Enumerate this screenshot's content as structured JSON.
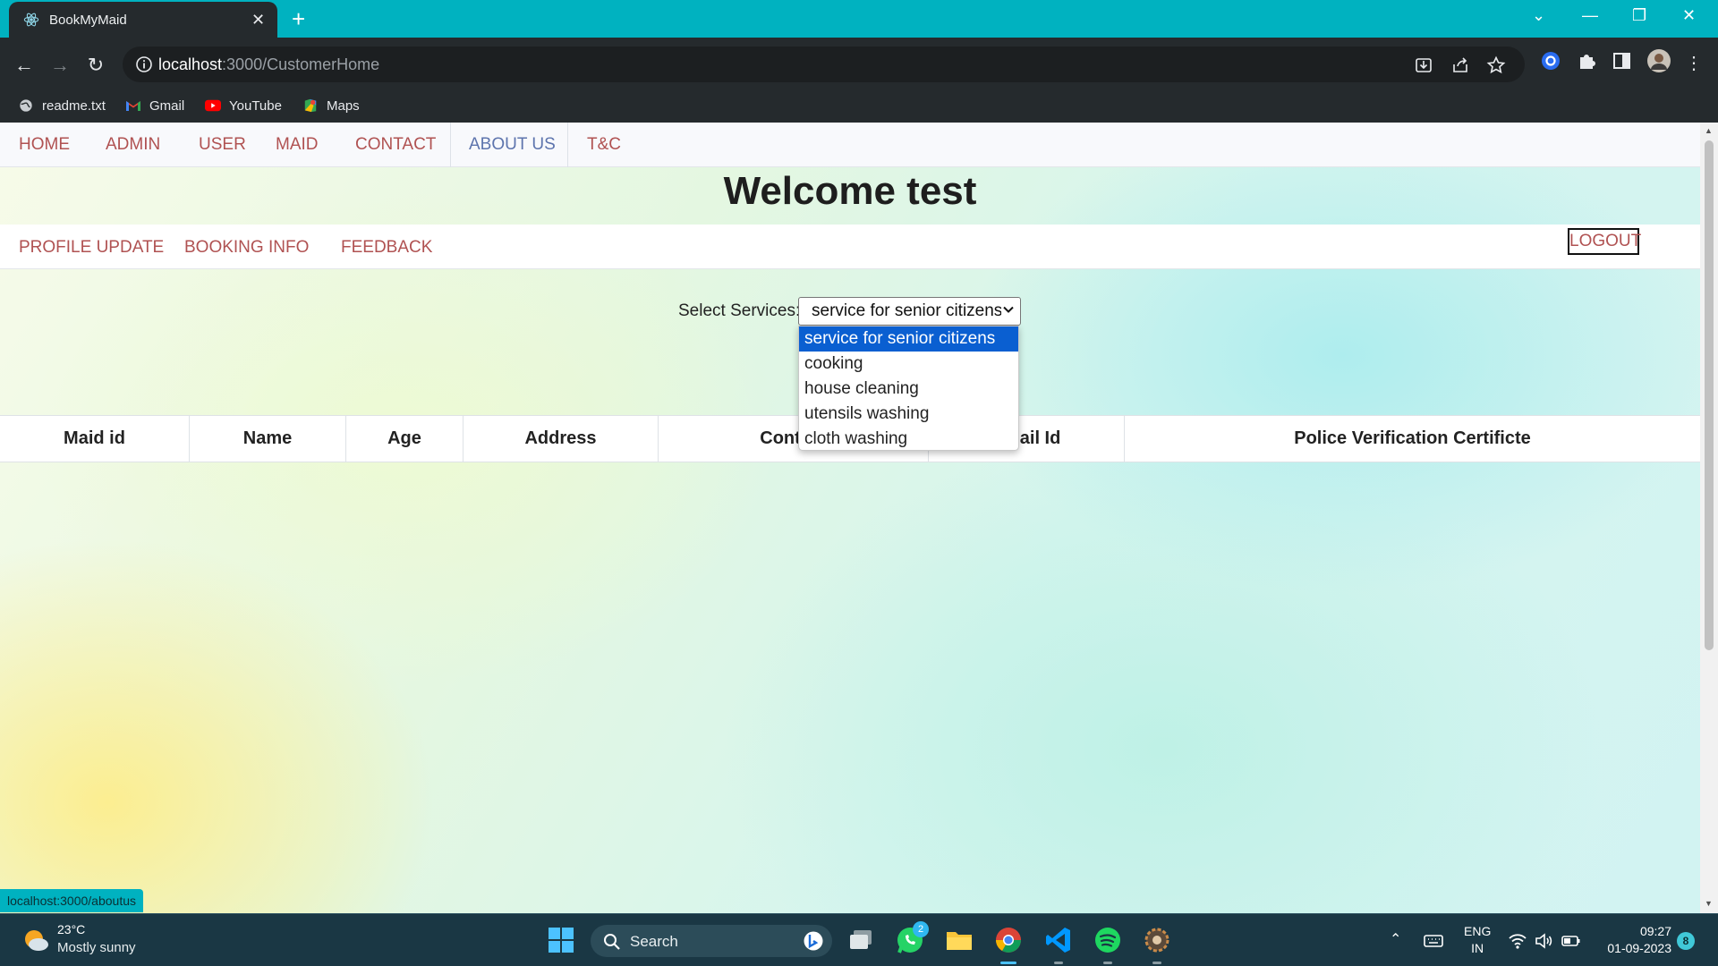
{
  "browser": {
    "tab_title": "BookMyMaid",
    "url_host": "localhost",
    "url_path": ":3000/CustomerHome",
    "bookmarks": [
      {
        "label": "readme.txt",
        "icon": "globe-icon"
      },
      {
        "label": "Gmail",
        "icon": "gmail-icon"
      },
      {
        "label": "YouTube",
        "icon": "youtube-icon"
      },
      {
        "label": "Maps",
        "icon": "maps-icon"
      }
    ],
    "status_url": "localhost:3000/aboutus"
  },
  "topnav": {
    "items": [
      "HOME",
      "ADMIN",
      "USER",
      "MAID",
      "CONTACT",
      "ABOUT US",
      "T&C"
    ]
  },
  "page": {
    "welcome": "Welcome test",
    "subnav": [
      "PROFILE UPDATE",
      "BOOKING INFO",
      "FEEDBACK"
    ],
    "logout_label": "LOGOUT",
    "select_label": "Select Services:",
    "select_value": "service for senior citizens",
    "select_options": [
      "service for senior citizens",
      "cooking",
      "house cleaning",
      "utensils washing",
      "cloth washing"
    ],
    "table_headers": [
      "Maid id",
      "Name",
      "Age",
      "Address",
      "Contact",
      "Email Id",
      "Police Verification Certificte"
    ]
  },
  "taskbar": {
    "temperature": "23°C",
    "weather": "Mostly sunny",
    "search_label": "Search",
    "whatsapp_badge": "2",
    "lang_top": "ENG",
    "lang_bottom": "IN",
    "time": "09:27",
    "date": "01-09-2023",
    "notifications": "8"
  },
  "colors": {
    "tabstrip": "#00b2c0",
    "nav_link": "#b05252",
    "nav_active": "#5d74ad",
    "option_highlight": "#0a5fd1"
  }
}
